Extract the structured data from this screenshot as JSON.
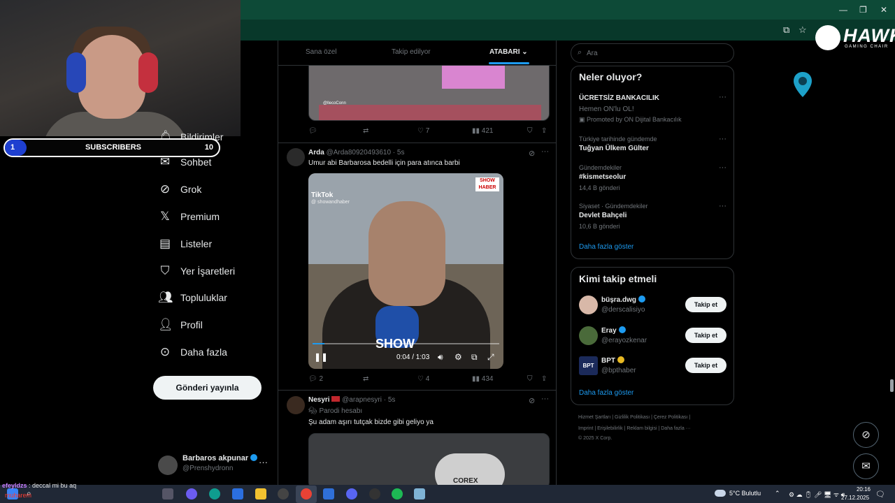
{
  "browser": {
    "icons": [
      "install-icon",
      "star-icon"
    ]
  },
  "overlay": {
    "brand": "HAWK",
    "brand_tagline": "GAMING CHAIR",
    "subscribers": {
      "label": "SUBSCRIBERS",
      "current": "1",
      "goal": "10",
      "progress": 0.1
    }
  },
  "nav": {
    "items": [
      {
        "label": "Bildirimler",
        "icon": "bell-icon"
      },
      {
        "label": "Sohbet",
        "icon": "mail-icon"
      },
      {
        "label": "Grok",
        "icon": "grok-icon"
      },
      {
        "label": "Premium",
        "icon": "x-logo-icon"
      },
      {
        "label": "Listeler",
        "icon": "list-icon"
      },
      {
        "label": "Yer İşaretleri",
        "icon": "bookmark-icon"
      },
      {
        "label": "Topluluklar",
        "icon": "people-icon"
      },
      {
        "label": "Profil",
        "icon": "user-icon"
      },
      {
        "label": "Daha fazla",
        "icon": "more-circle-icon"
      }
    ],
    "post_button": "Gönderi yayınla",
    "account": {
      "name": "Barbaros akpunar",
      "handle": "@Prenshydronn"
    }
  },
  "feed": {
    "tabs": [
      "Sana özel",
      "Takip edilyor",
      "ATABARI"
    ],
    "active_tab": "ATABARI",
    "prev_post": {
      "replies": "",
      "reposts": "",
      "likes": "7",
      "views": "421",
      "image_caption": "@llecoConn"
    },
    "tweet1": {
      "name": "Arda",
      "handle": "@Arda80920493610",
      "time": "5s",
      "text": "Umur abi Barbarosa bedelli için para atınca barbi",
      "video": {
        "source": "TikTok",
        "source_handle": "@ showandhaber",
        "channel": "SHOW HABER",
        "overlay_text": "SHOW",
        "time": "0:04 / 1:03",
        "progress": 0.063
      },
      "replies": "2",
      "reposts": "",
      "likes": "4",
      "views": "434"
    },
    "tweet2": {
      "name": "Nesyri",
      "handle": "@arapnesyri",
      "time": "5s",
      "label": "Parodi hesabı",
      "text": "Şu adam aşırı tutçak bizde gibi geliyo ya",
      "image_text": "COREX"
    }
  },
  "sidebar": {
    "search_placeholder": "Ara",
    "trends_title": "Neler oluyor?",
    "trends": [
      {
        "top": "",
        "title": "ÜCRETSİZ BANKACILIK",
        "sub": "Hemen ON'lu OL!",
        "promo": "Promoted by ON Dijital Bankacılık"
      },
      {
        "top": "Türkiye tarihinde gündemde",
        "title": "Tuğyan Ülkem Gülter",
        "sub": ""
      },
      {
        "top": "Gündemdekiler",
        "title": "#kismetseolur",
        "sub": "14,4 B gönderi"
      },
      {
        "top": "Siyaset · Gündemdekiler",
        "title": "Devlet Bahçeli",
        "sub": "10,6 B gönderi"
      }
    ],
    "trends_more": "Daha fazla göster",
    "who_title": "Kimi takip etmeli",
    "who": [
      {
        "name": "büşra.dwg",
        "handle": "@derscalisiyo",
        "badge": "blue",
        "button": "Takip et"
      },
      {
        "name": "Eray",
        "handle": "@erayozkenar",
        "badge": "blue",
        "button": "Takip et"
      },
      {
        "name": "BPT",
        "handle": "@bpthaber",
        "badge": "gold",
        "button": "Takip et",
        "avatar_text": "BPT"
      }
    ],
    "who_more": "Daha fazla göster",
    "footer_line1": "Hizmet Şartları  |  Gizlilik Politikası  |  Çerez Politikası  |",
    "footer_line2": "Imprint  |  Erişilebilirlik  |  Reklam bilgisi  |  Daha fazla ···",
    "footer_line3": "© 2025 X Corp."
  },
  "chat": {
    "user": "efeyldzs",
    "message": "deccal mi bu aq",
    "user2": "muharem"
  },
  "taskbar": {
    "weather": "5°C  Bulutlu",
    "time": "20:16",
    "date": "27.12.2025"
  },
  "colors": {
    "accent": "#1d9bf0",
    "chrome": "#0d4a37",
    "taskbar": "#202836"
  }
}
